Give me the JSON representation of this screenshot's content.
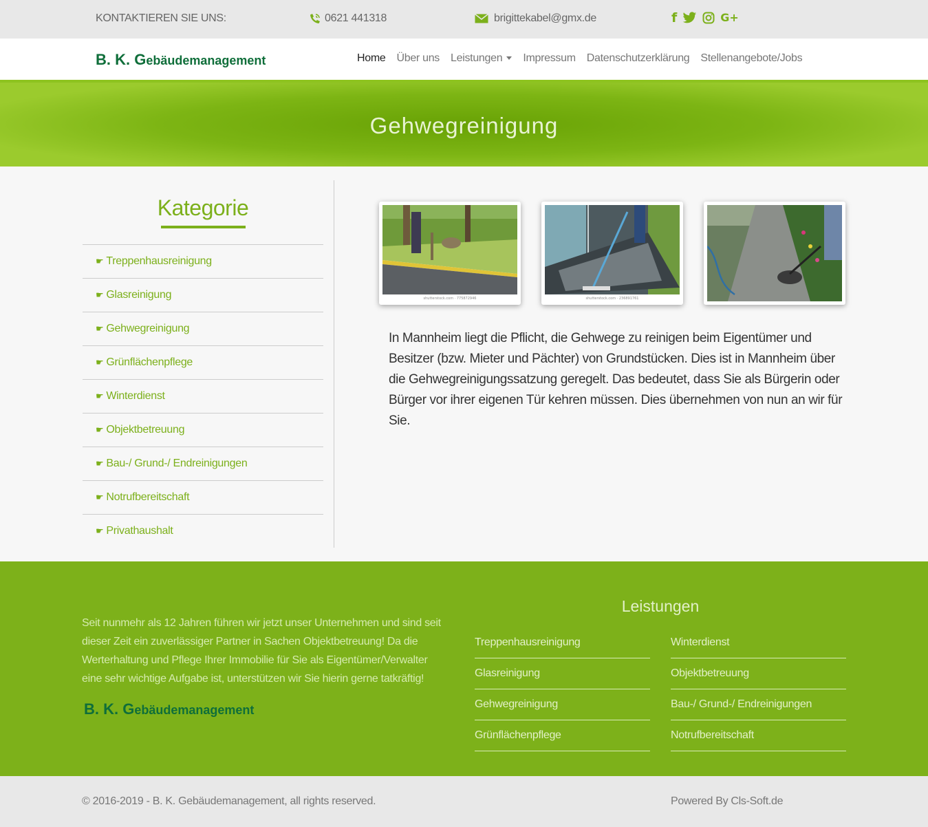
{
  "topbar": {
    "contact_label": "KONTAKTIEREN SIE UNS:",
    "phone": "0621 441318",
    "email": "brigittekabel@gmx.de",
    "social_icons": [
      "facebook-icon",
      "twitter-icon",
      "instagram-icon",
      "google-plus-icon"
    ]
  },
  "brand": {
    "initials": "B. K. G",
    "rest": "ebäudemanagement"
  },
  "nav": {
    "items": [
      {
        "label": "Home",
        "active": true
      },
      {
        "label": "Über uns"
      },
      {
        "label": "Leistungen",
        "dropdown": true
      },
      {
        "label": "Impressum"
      },
      {
        "label": "Datenschutzerklärung"
      },
      {
        "label": "Stellenangebote/Jobs"
      }
    ]
  },
  "hero": {
    "title": "Gehwegreinigung"
  },
  "sidebar": {
    "title": "Kategorie",
    "items": [
      "Treppenhausreinigung",
      "Glasreinigung",
      "Gehwegreinigung",
      "Grünflächenpflege",
      "Winterdienst",
      "Objektbetreuung",
      "Bau-/ Grund-/ Endreinigungen",
      "Notrufbereitschaft",
      "Privathaushalt"
    ]
  },
  "gallery": {
    "captions": [
      "shutterstock.com · 775872946",
      "shutterstock.com · 236891761"
    ]
  },
  "article": {
    "text": "In Mannheim liegt die Pflicht, die Gehwege zu reinigen beim Eigentümer und Besitzer (bzw. Mieter und Pächter) von Grundstücken. Dies ist in Mannheim über die Gehwegreinigungssatzung geregelt. Das bedeutet, dass Sie als Bürgerin oder Bürger vor ihrer eigenen Tür kehren müssen. Dies übernehmen von nun an wir für Sie."
  },
  "footer": {
    "about": "Seit nunmehr als 12 Jahren führen wir jetzt unser Unternehmen und sind seit dieser Zeit ein zuverlässiger Partner in Sachen Objektbetreuung! Da die Werterhaltung und Pflege Ihrer Immobilie für Sie als Eigentümer/Verwalter eine sehr wichtige Aufgabe ist, unterstützen wir Sie hierin gerne tatkräftig!",
    "services_title": "Leistungen",
    "col1": [
      "Treppenhausreinigung",
      "Glasreinigung",
      "Gehwegreinigung",
      "Grünflächenpflege"
    ],
    "col2": [
      "Winterdienst",
      "Objektbetreuung",
      "Bau-/ Grund-/ Endreinigungen",
      "Notrufbereitschaft"
    ],
    "copyright": "© 2016-2019 - B. K. Gebäudemanagement, all rights reserved.",
    "powered": "Powered By Cls-Soft.de"
  },
  "colors": {
    "accent": "#7cb01b",
    "brand": "#0f6e3a",
    "footer_bg": "#7db11a"
  }
}
